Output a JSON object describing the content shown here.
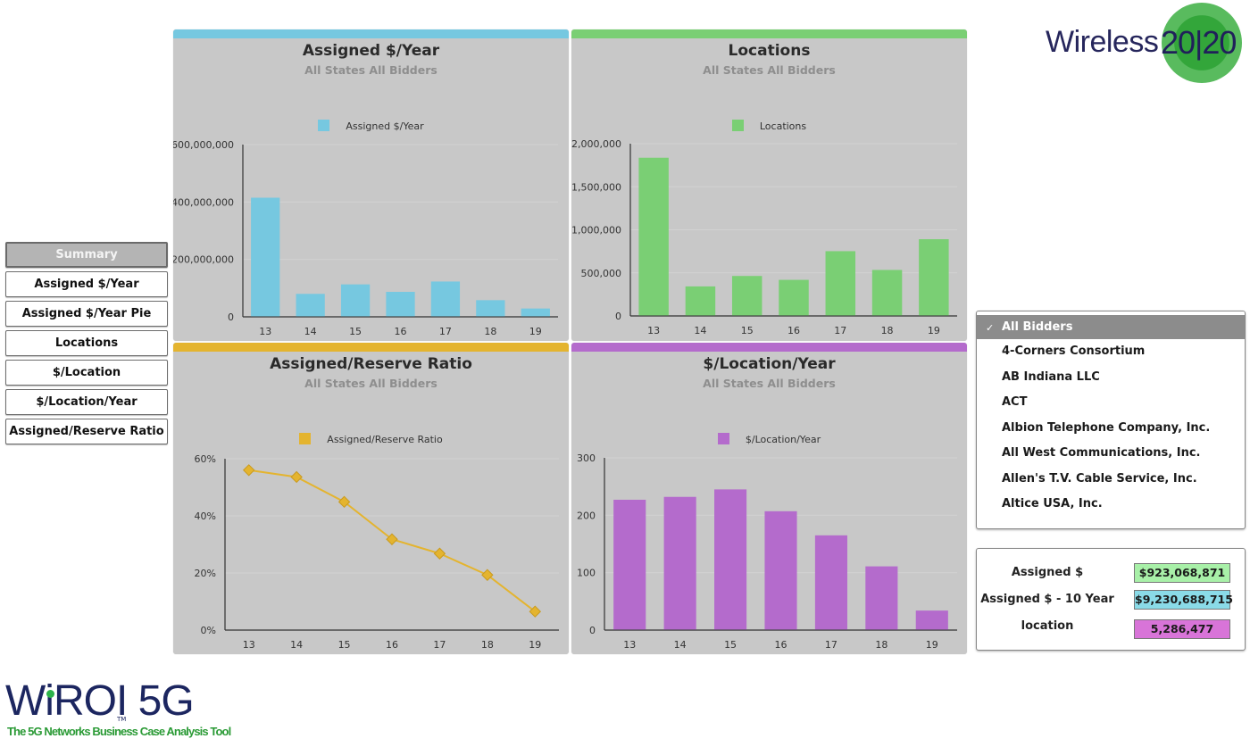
{
  "nav": {
    "items": [
      {
        "label": "Summary",
        "active": true
      },
      {
        "label": "Assigned $/Year",
        "active": false
      },
      {
        "label": "Assigned $/Year Pie",
        "active": false
      },
      {
        "label": "Locations",
        "active": false
      },
      {
        "label": "$/Location",
        "active": false
      },
      {
        "label": "$/Location/Year",
        "active": false
      },
      {
        "label": "Assigned/Reserve Ratio",
        "active": false
      }
    ]
  },
  "logo": {
    "brand_word": "Wireless",
    "brand_number": "20|20",
    "product": "WiROI",
    "product_suffix": "5G",
    "trademark": "TM",
    "tagline": "The 5G Networks Business Case Analysis Tool"
  },
  "colors": {
    "assigned_year": "#76c8e0",
    "locations": "#7acf74",
    "ratio": "#e4b42f",
    "loc_year": "#b46bcc",
    "panel_bg": "#c8c8c8"
  },
  "bidders": {
    "selected": "All Bidders",
    "items": [
      "All Bidders",
      "4-Corners Consortium",
      "AB Indiana LLC",
      "ACT",
      "Albion Telephone Company, Inc.",
      "All West Communications, Inc.",
      "Allen's T.V. Cable Service, Inc.",
      "Altice USA, Inc."
    ]
  },
  "summary": {
    "rows": [
      {
        "label": "Assigned $",
        "value": "$923,068,871",
        "color": "#a8f0a8"
      },
      {
        "label": "Assigned $ - 10 Year",
        "value": "$9,230,688,715",
        "color": "#8adbe8"
      },
      {
        "label": "location",
        "value": "5,286,477",
        "color": "#d874d8"
      }
    ]
  },
  "chart_data": [
    {
      "id": "assigned-year",
      "type": "bar",
      "title": "Assigned $/Year",
      "subtitle": "All States All Bidders",
      "legend": "Assigned $/Year",
      "legend_position": "top-center",
      "categories": [
        "13",
        "14",
        "15",
        "16",
        "17",
        "18",
        "19"
      ],
      "values": [
        415000000,
        80000000,
        113000000,
        87000000,
        123000000,
        58000000,
        29000000
      ],
      "yticks": [
        0,
        200000000,
        400000000,
        600000000
      ],
      "ytick_labels": [
        "0",
        "200,000,000",
        "400,000,000",
        "600,000,000"
      ],
      "ylim": [
        0,
        600000000
      ],
      "grid": true,
      "color": "#76c8e0"
    },
    {
      "id": "locations",
      "type": "bar",
      "title": "Locations",
      "subtitle": "All States All Bidders",
      "legend": "Locations",
      "legend_position": "top-center",
      "categories": [
        "13",
        "14",
        "15",
        "16",
        "17",
        "18",
        "19"
      ],
      "values": [
        1837000,
        343000,
        464000,
        419000,
        752000,
        534000,
        891000
      ],
      "yticks": [
        0,
        500000,
        1000000,
        1500000,
        2000000
      ],
      "ytick_labels": [
        "0",
        "500,000",
        "1,000,000",
        "1,500,000",
        "2,000,000"
      ],
      "ylim": [
        0,
        2000000
      ],
      "grid": true,
      "color": "#7acf74"
    },
    {
      "id": "assigned-reserve-ratio",
      "type": "line",
      "title": "Assigned/Reserve Ratio",
      "subtitle": "All States All Bidders",
      "legend": "Assigned/Reserve Ratio",
      "legend_position": "top-center",
      "categories": [
        "13",
        "14",
        "15",
        "16",
        "17",
        "18",
        "19"
      ],
      "values": [
        0.56,
        0.536,
        0.449,
        0.318,
        0.268,
        0.193,
        0.065
      ],
      "yticks": [
        0,
        0.2,
        0.4,
        0.6
      ],
      "ytick_labels": [
        "0%",
        "20%",
        "40%",
        "60%"
      ],
      "ylim": [
        0,
        0.6
      ],
      "grid": true,
      "marker": "diamond",
      "color": "#e4b42f"
    },
    {
      "id": "location-year",
      "type": "bar",
      "title": "$/Location/Year",
      "subtitle": "All States All Bidders",
      "legend": "$/Location/Year",
      "legend_position": "top-center",
      "categories": [
        "13",
        "14",
        "15",
        "16",
        "17",
        "18",
        "19"
      ],
      "values": [
        227,
        232,
        245,
        207,
        165,
        111,
        34
      ],
      "yticks": [
        0,
        100,
        200,
        300
      ],
      "ytick_labels": [
        "0",
        "100",
        "200",
        "300"
      ],
      "ylim": [
        0,
        300
      ],
      "grid": true,
      "color": "#b46bcc"
    }
  ]
}
